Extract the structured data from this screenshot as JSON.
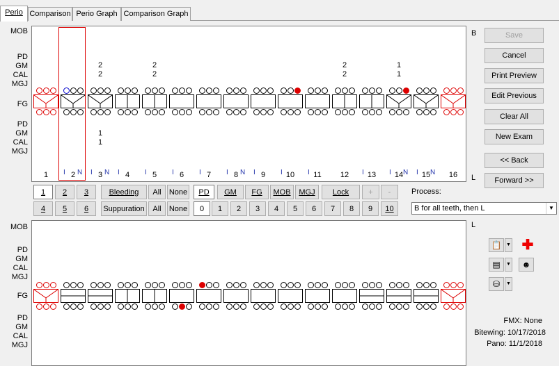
{
  "tabs": [
    "Perio",
    "Comparison",
    "Perio Graph",
    "Comparison Graph"
  ],
  "upper": {
    "label_side_top": "B",
    "label_side_bottom": "L",
    "row_labels_top": [
      "MOB",
      "PD",
      "GM",
      "CAL",
      "MGJ"
    ],
    "fg_label": "FG",
    "row_labels_bottom": [
      "PD",
      "GM",
      "CAL",
      "MGJ"
    ],
    "teeth_numbers": [
      "1",
      "2",
      "3",
      "4",
      "5",
      "6",
      "7",
      "8",
      "9",
      "10",
      "11",
      "12",
      "13",
      "14",
      "15",
      "16"
    ],
    "gm_values": {
      "3": "2",
      "5": "2",
      "12": "2",
      "14": "1"
    },
    "cal_values": {
      "3": "2",
      "5": "2",
      "12": "2",
      "14": "1"
    },
    "lingual_gm": {
      "3": "1"
    },
    "lingual_cal": {
      "3": "1"
    },
    "implant_markers": [
      {
        "tooth": "2",
        "text": "I",
        "n": "N"
      },
      {
        "tooth": "3",
        "text": "I",
        "n": "N"
      },
      {
        "tooth": "4",
        "text": "I",
        "n": ""
      },
      {
        "tooth": "5",
        "text": "I",
        "n": ""
      },
      {
        "tooth": "6",
        "text": "I",
        "n": ""
      },
      {
        "tooth": "7",
        "text": "I",
        "n": ""
      },
      {
        "tooth": "8",
        "text": "I",
        "n": "N"
      },
      {
        "tooth": "9",
        "text": "I",
        "n": ""
      },
      {
        "tooth": "10",
        "text": "I",
        "n": ""
      },
      {
        "tooth": "11",
        "text": "I",
        "n": ""
      },
      {
        "tooth": "13",
        "text": "I",
        "n": ""
      },
      {
        "tooth": "14",
        "text": "I",
        "n": "N"
      },
      {
        "tooth": "15",
        "text": "I",
        "n": "N"
      }
    ]
  },
  "lower": {
    "label_side_top": "L",
    "row_labels_top": [
      "MOB",
      "PD",
      "GM",
      "CAL",
      "MGJ"
    ],
    "fg_label": "FG",
    "row_labels_bottom": [
      "PD",
      "GM",
      "CAL",
      "MGJ"
    ]
  },
  "side_buttons": {
    "save": "Save",
    "cancel": "Cancel",
    "print_preview": "Print Preview",
    "edit_previous": "Edit Previous",
    "clear_all": "Clear All",
    "new_exam": "New Exam",
    "back": "<< Back",
    "forward": "Forward >>"
  },
  "controls": {
    "row1_nums": [
      "1",
      "2",
      "3"
    ],
    "row2_nums": [
      "4",
      "5",
      "6"
    ],
    "bleeding": "Bleeding",
    "suppuration": "Suppuration",
    "all": "All",
    "none": "None",
    "modes": [
      "PD",
      "GM",
      "FG",
      "MOB",
      "MGJ"
    ],
    "lock": "Lock",
    "plus": "+",
    "minus": "-",
    "digits": [
      "0",
      "1",
      "2",
      "3",
      "4",
      "5",
      "6",
      "7",
      "8",
      "9",
      "10"
    ],
    "process_label": "Process:",
    "process_value": "B for all teeth, then L"
  },
  "xray": {
    "fmx": "FMX: None",
    "bitewing": "Bitewing: 10/17/2018",
    "pano": "Pano: 11/1/2018"
  }
}
